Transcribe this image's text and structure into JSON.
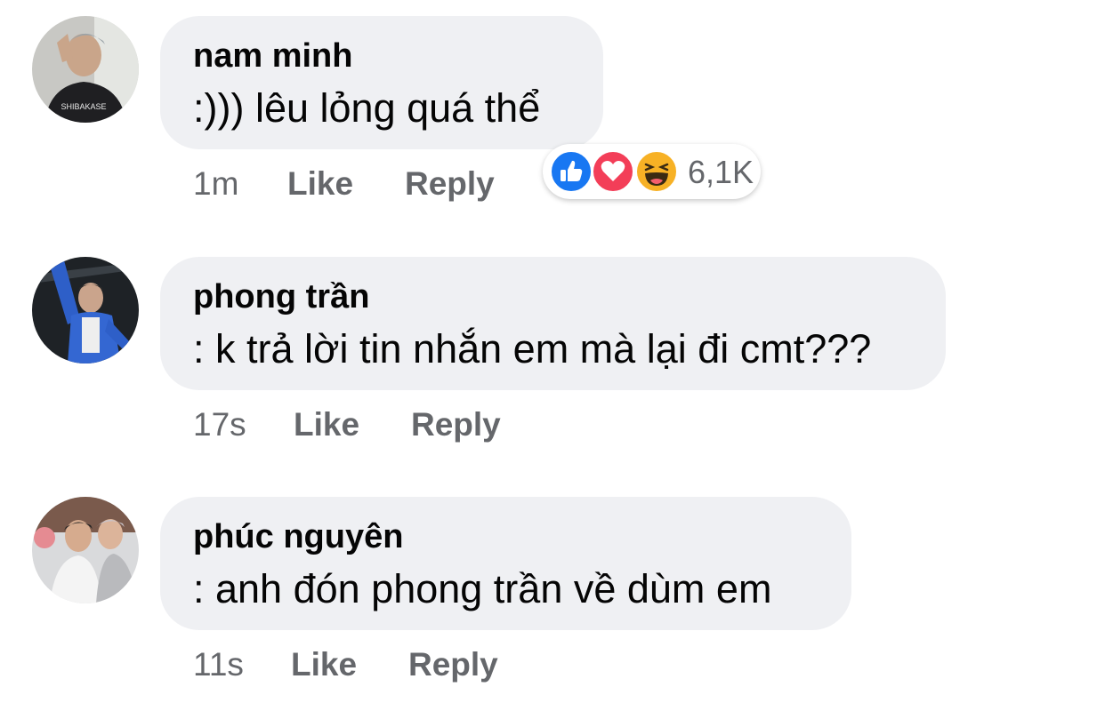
{
  "comments": [
    {
      "name": "nam minh",
      "text": ":))) lêu lỏng quá thể",
      "time": "1m",
      "like_label": "Like",
      "reply_label": "Reply",
      "reactions": {
        "icons": [
          "like-icon",
          "love-icon",
          "haha-icon"
        ],
        "count": "6,1K"
      }
    },
    {
      "name": "phong trần",
      "text": ": k trả lời tin nhắn em mà lại đi cmt???",
      "time": "17s",
      "like_label": "Like",
      "reply_label": "Reply"
    },
    {
      "name": "phúc nguyên",
      "text": ": anh đón phong trần về dùm em",
      "time": "11s",
      "like_label": "Like",
      "reply_label": "Reply"
    }
  ],
  "colors": {
    "bubble": "#eff0f3",
    "meta_text": "#65676b",
    "like_blue": "#1877f2",
    "love_red": "#f33e58",
    "haha_yellow": "#f7b125"
  }
}
